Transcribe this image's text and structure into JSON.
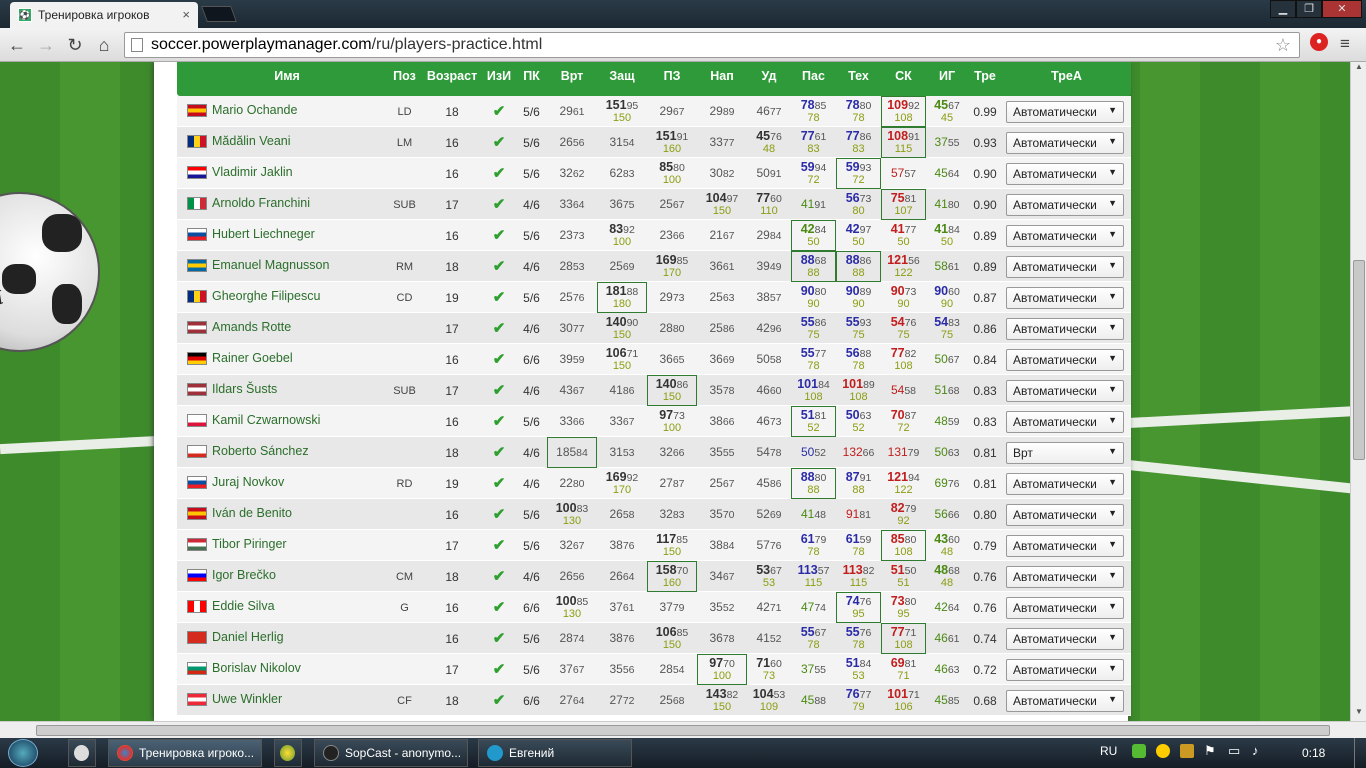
{
  "browser": {
    "tab_title": "Тренировка игроков",
    "tab_close": "×",
    "url_host": "soccer.powerplaymanager.com",
    "url_path": "/ru/players-practice.html",
    "window_min": "▁",
    "window_max": "❐",
    "window_close": "✕"
  },
  "table": {
    "headers": [
      "Имя",
      "Поз",
      "Возраст",
      "ИзИ",
      "ПК",
      "Врт",
      "Защ",
      "ПЗ",
      "Нап",
      "Уд",
      "Пас",
      "Тех",
      "СК",
      "ИГ",
      "Тре",
      "ТреА"
    ],
    "rows": [
      {
        "name": "Mario Ochande",
        "flag": "es",
        "pos": "LD",
        "age": "18",
        "pk": "5/6",
        "vrt": [
          "29",
          "61"
        ],
        "zash": [
          "151",
          "95",
          "150"
        ],
        "pz": [
          "29",
          "67"
        ],
        "nap": [
          "29",
          "89"
        ],
        "ud": [
          "46",
          "77"
        ],
        "pas": [
          "78",
          "85",
          "78"
        ],
        "teh": [
          "78",
          "80",
          "78"
        ],
        "sk": [
          "109",
          "92",
          "108"
        ],
        "ig": [
          "45",
          "67",
          "45"
        ],
        "tre": "0.99",
        "trea": "Автоматически"
      },
      {
        "name": "Mădălin Veani",
        "flag": "ro",
        "pos": "LM",
        "age": "16",
        "pk": "5/6",
        "vrt": [
          "26",
          "56"
        ],
        "zash": [
          "31",
          "54"
        ],
        "pz": [
          "151",
          "91",
          "160"
        ],
        "nap": [
          "33",
          "77"
        ],
        "ud": [
          "45",
          "76",
          "48"
        ],
        "pas": [
          "77",
          "61",
          "83"
        ],
        "teh": [
          "77",
          "86",
          "83"
        ],
        "sk": [
          "108",
          "91",
          "115"
        ],
        "ig": [
          "37",
          "55"
        ],
        "tre": "0.93",
        "trea": "Автоматически"
      },
      {
        "name": "Vladimir Jaklin",
        "flag": "hr",
        "pos": "",
        "age": "16",
        "pk": "5/6",
        "vrt": [
          "32",
          "62"
        ],
        "zash": [
          "62",
          "83"
        ],
        "pz": [
          "85",
          "80",
          "100"
        ],
        "nap": [
          "30",
          "82"
        ],
        "ud": [
          "50",
          "91"
        ],
        "pas": [
          "59",
          "94",
          "72"
        ],
        "teh": [
          "59",
          "93",
          "72"
        ],
        "sk": [
          "57",
          "57"
        ],
        "ig": [
          "45",
          "64"
        ],
        "tre": "0.90",
        "trea": "Автоматически"
      },
      {
        "name": "Arnoldo Franchini",
        "flag": "it",
        "pos": "SUB",
        "age": "17",
        "pk": "4/6",
        "vrt": [
          "33",
          "64"
        ],
        "zash": [
          "36",
          "75"
        ],
        "pz": [
          "25",
          "67"
        ],
        "nap": [
          "104",
          "97",
          "150"
        ],
        "ud": [
          "77",
          "60",
          "110"
        ],
        "pas": [
          "41",
          "91"
        ],
        "teh": [
          "56",
          "73",
          "80"
        ],
        "sk": [
          "75",
          "81",
          "107"
        ],
        "ig": [
          "41",
          "80"
        ],
        "tre": "0.90",
        "trea": "Автоматически"
      },
      {
        "name": "Hubert Liechneger",
        "flag": "sk",
        "pos": "",
        "age": "16",
        "pk": "5/6",
        "vrt": [
          "23",
          "73"
        ],
        "zash": [
          "83",
          "92",
          "100"
        ],
        "pz": [
          "23",
          "66"
        ],
        "nap": [
          "21",
          "67"
        ],
        "ud": [
          "29",
          "84"
        ],
        "pas": [
          "42",
          "84",
          "50"
        ],
        "teh": [
          "42",
          "97",
          "50"
        ],
        "sk": [
          "41",
          "77",
          "50"
        ],
        "ig": [
          "41",
          "84",
          "50"
        ],
        "tre": "0.89",
        "trea": "Автоматически"
      },
      {
        "name": "Emanuel Magnusson",
        "flag": "se",
        "pos": "RM",
        "age": "18",
        "pk": "4/6",
        "vrt": [
          "28",
          "53"
        ],
        "zash": [
          "25",
          "69"
        ],
        "pz": [
          "169",
          "85",
          "170"
        ],
        "nap": [
          "36",
          "61"
        ],
        "ud": [
          "39",
          "49"
        ],
        "pas": [
          "88",
          "68",
          "88"
        ],
        "teh": [
          "88",
          "86",
          "88"
        ],
        "sk": [
          "121",
          "56",
          "122"
        ],
        "ig": [
          "58",
          "61"
        ],
        "tre": "0.89",
        "trea": "Автоматически"
      },
      {
        "name": "Gheorghe Filipescu",
        "flag": "ro",
        "pos": "CD",
        "age": "19",
        "pk": "5/6",
        "vrt": [
          "25",
          "76"
        ],
        "zash": [
          "181",
          "88",
          "180"
        ],
        "pz": [
          "29",
          "73"
        ],
        "nap": [
          "25",
          "63"
        ],
        "ud": [
          "38",
          "57"
        ],
        "pas": [
          "90",
          "80",
          "90"
        ],
        "teh": [
          "90",
          "89",
          "90"
        ],
        "sk": [
          "90",
          "73",
          "90"
        ],
        "ig": [
          "90",
          "60",
          "90"
        ],
        "tre": "0.87",
        "trea": "Автоматически"
      },
      {
        "name": "Amands Rotte",
        "flag": "lv",
        "pos": "",
        "age": "17",
        "pk": "4/6",
        "vrt": [
          "30",
          "77"
        ],
        "zash": [
          "140",
          "90",
          "150"
        ],
        "pz": [
          "28",
          "80"
        ],
        "nap": [
          "25",
          "86"
        ],
        "ud": [
          "42",
          "96"
        ],
        "pas": [
          "55",
          "86",
          "75"
        ],
        "teh": [
          "55",
          "93",
          "75"
        ],
        "sk": [
          "54",
          "76",
          "75"
        ],
        "ig": [
          "54",
          "83",
          "75"
        ],
        "tre": "0.86",
        "trea": "Автоматически"
      },
      {
        "name": "Rainer Goebel",
        "flag": "de",
        "pos": "",
        "age": "16",
        "pk": "6/6",
        "vrt": [
          "39",
          "59"
        ],
        "zash": [
          "106",
          "71",
          "150"
        ],
        "pz": [
          "36",
          "65"
        ],
        "nap": [
          "36",
          "69"
        ],
        "ud": [
          "50",
          "58"
        ],
        "pas": [
          "55",
          "77",
          "78"
        ],
        "teh": [
          "56",
          "88",
          "78"
        ],
        "sk": [
          "77",
          "82",
          "108"
        ],
        "ig": [
          "50",
          "67"
        ],
        "tre": "0.84",
        "trea": "Автоматически"
      },
      {
        "name": "Ildars Šusts",
        "flag": "lv",
        "pos": "SUB",
        "age": "17",
        "pk": "4/6",
        "vrt": [
          "43",
          "67"
        ],
        "zash": [
          "41",
          "86"
        ],
        "pz": [
          "140",
          "86",
          "150"
        ],
        "nap": [
          "35",
          "78"
        ],
        "ud": [
          "46",
          "60"
        ],
        "pas": [
          "101",
          "84",
          "108"
        ],
        "teh": [
          "101",
          "89",
          "108"
        ],
        "sk": [
          "54",
          "58"
        ],
        "ig": [
          "51",
          "68"
        ],
        "tre": "0.83",
        "trea": "Автоматически"
      },
      {
        "name": "Kamil Czwarnowski",
        "flag": "pl",
        "pos": "",
        "age": "16",
        "pk": "5/6",
        "vrt": [
          "33",
          "66"
        ],
        "zash": [
          "33",
          "67"
        ],
        "pz": [
          "97",
          "73",
          "100"
        ],
        "nap": [
          "38",
          "66"
        ],
        "ud": [
          "46",
          "73"
        ],
        "pas": [
          "51",
          "81",
          "52"
        ],
        "teh": [
          "50",
          "63",
          "52"
        ],
        "sk": [
          "70",
          "87",
          "72"
        ],
        "ig": [
          "48",
          "59"
        ],
        "tre": "0.83",
        "trea": "Автоматически"
      },
      {
        "name": "Roberto Sánchez",
        "flag": "cl",
        "pos": "",
        "age": "18",
        "pk": "4/6",
        "vrt": [
          "185",
          "84"
        ],
        "zash": [
          "31",
          "53"
        ],
        "pz": [
          "32",
          "66"
        ],
        "nap": [
          "35",
          "55"
        ],
        "ud": [
          "54",
          "78"
        ],
        "pas": [
          "50",
          "52"
        ],
        "teh": [
          "132",
          "66"
        ],
        "sk": [
          "131",
          "79"
        ],
        "ig": [
          "50",
          "63"
        ],
        "tre": "0.81",
        "trea": "Врт"
      },
      {
        "name": "Juraj Novkov",
        "flag": "sk",
        "pos": "RD",
        "age": "19",
        "pk": "4/6",
        "vrt": [
          "22",
          "80"
        ],
        "zash": [
          "169",
          "92",
          "170"
        ],
        "pz": [
          "27",
          "87"
        ],
        "nap": [
          "25",
          "67"
        ],
        "ud": [
          "45",
          "86"
        ],
        "pas": [
          "88",
          "80",
          "88"
        ],
        "teh": [
          "87",
          "91",
          "88"
        ],
        "sk": [
          "121",
          "94",
          "122"
        ],
        "ig": [
          "69",
          "76"
        ],
        "tre": "0.81",
        "trea": "Автоматически"
      },
      {
        "name": "Iván de Benito",
        "flag": "es",
        "pos": "",
        "age": "16",
        "pk": "5/6",
        "vrt": [
          "100",
          "83",
          "130"
        ],
        "zash": [
          "26",
          "58"
        ],
        "pz": [
          "32",
          "83"
        ],
        "nap": [
          "35",
          "70"
        ],
        "ud": [
          "52",
          "69"
        ],
        "pas": [
          "41",
          "48"
        ],
        "teh": [
          "91",
          "81"
        ],
        "sk": [
          "82",
          "79",
          "92"
        ],
        "ig": [
          "56",
          "66"
        ],
        "tre": "0.80",
        "trea": "Автоматически"
      },
      {
        "name": "Tibor Piringer",
        "flag": "hu",
        "pos": "",
        "age": "17",
        "pk": "5/6",
        "vrt": [
          "32",
          "67"
        ],
        "zash": [
          "38",
          "76"
        ],
        "pz": [
          "117",
          "85",
          "150"
        ],
        "nap": [
          "38",
          "84"
        ],
        "ud": [
          "57",
          "76"
        ],
        "pas": [
          "61",
          "79",
          "78"
        ],
        "teh": [
          "61",
          "59",
          "78"
        ],
        "sk": [
          "85",
          "80",
          "108"
        ],
        "ig": [
          "43",
          "60",
          "48"
        ],
        "tre": "0.79",
        "trea": "Автоматически"
      },
      {
        "name": "Igor Brečko",
        "flag": "si",
        "pos": "CM",
        "age": "18",
        "pk": "4/6",
        "vrt": [
          "26",
          "56"
        ],
        "zash": [
          "26",
          "64"
        ],
        "pz": [
          "158",
          "70",
          "160"
        ],
        "nap": [
          "34",
          "67"
        ],
        "ud": [
          "53",
          "67",
          "53"
        ],
        "pas": [
          "113",
          "57",
          "115"
        ],
        "teh": [
          "113",
          "82",
          "115"
        ],
        "sk": [
          "51",
          "50",
          "51"
        ],
        "ig": [
          "48",
          "68",
          "48"
        ],
        "tre": "0.76",
        "trea": "Автоматически"
      },
      {
        "name": "Eddie Silva",
        "flag": "ca",
        "pos": "G",
        "age": "16",
        "pk": "6/6",
        "vrt": [
          "100",
          "85",
          "130"
        ],
        "zash": [
          "37",
          "61"
        ],
        "pz": [
          "37",
          "79"
        ],
        "nap": [
          "35",
          "52"
        ],
        "ud": [
          "42",
          "71"
        ],
        "pas": [
          "47",
          "74"
        ],
        "teh": [
          "74",
          "76",
          "95"
        ],
        "sk": [
          "73",
          "80",
          "95"
        ],
        "ig": [
          "42",
          "64"
        ],
        "tre": "0.76",
        "trea": "Автоматически"
      },
      {
        "name": "Daniel Herlig",
        "flag": "ch",
        "pos": "",
        "age": "16",
        "pk": "5/6",
        "vrt": [
          "28",
          "74"
        ],
        "zash": [
          "38",
          "76"
        ],
        "pz": [
          "106",
          "85",
          "150"
        ],
        "nap": [
          "36",
          "78"
        ],
        "ud": [
          "41",
          "52"
        ],
        "pas": [
          "55",
          "67",
          "78"
        ],
        "teh": [
          "55",
          "76",
          "78"
        ],
        "sk": [
          "77",
          "71",
          "108"
        ],
        "ig": [
          "46",
          "61"
        ],
        "tre": "0.74",
        "trea": "Автоматически"
      },
      {
        "name": "Borislav Nikolov",
        "flag": "bg",
        "pos": "",
        "age": "17",
        "pk": "5/6",
        "vrt": [
          "37",
          "67"
        ],
        "zash": [
          "35",
          "56"
        ],
        "pz": [
          "28",
          "54"
        ],
        "nap": [
          "97",
          "70",
          "100"
        ],
        "ud": [
          "71",
          "60",
          "73"
        ],
        "pas": [
          "37",
          "55"
        ],
        "teh": [
          "51",
          "84",
          "53"
        ],
        "sk": [
          "69",
          "81",
          "71"
        ],
        "ig": [
          "46",
          "63"
        ],
        "tre": "0.72",
        "trea": "Автоматически"
      },
      {
        "name": "Uwe Winkler",
        "flag": "at",
        "pos": "CF",
        "age": "18",
        "pk": "6/6",
        "vrt": [
          "27",
          "64"
        ],
        "zash": [
          "27",
          "72"
        ],
        "pz": [
          "25",
          "68"
        ],
        "nap": [
          "143",
          "82",
          "150"
        ],
        "ud": [
          "104",
          "53",
          "109"
        ],
        "pas": [
          "45",
          "88"
        ],
        "teh": [
          "76",
          "77",
          "79"
        ],
        "sk": [
          "101",
          "71",
          "106"
        ],
        "ig": [
          "45",
          "85"
        ],
        "tre": "0.68",
        "trea": "Автоматически"
      }
    ]
  },
  "taskbar": {
    "items": [
      "Тренировка игроко...",
      "SopCast - anonymo...",
      "Евгений"
    ],
    "lang": "RU",
    "clock": "0:18"
  },
  "colors": {
    "header_green": "#2f9a3a",
    "name_green": "#2b6e2b",
    "check": "#2ea02e"
  }
}
